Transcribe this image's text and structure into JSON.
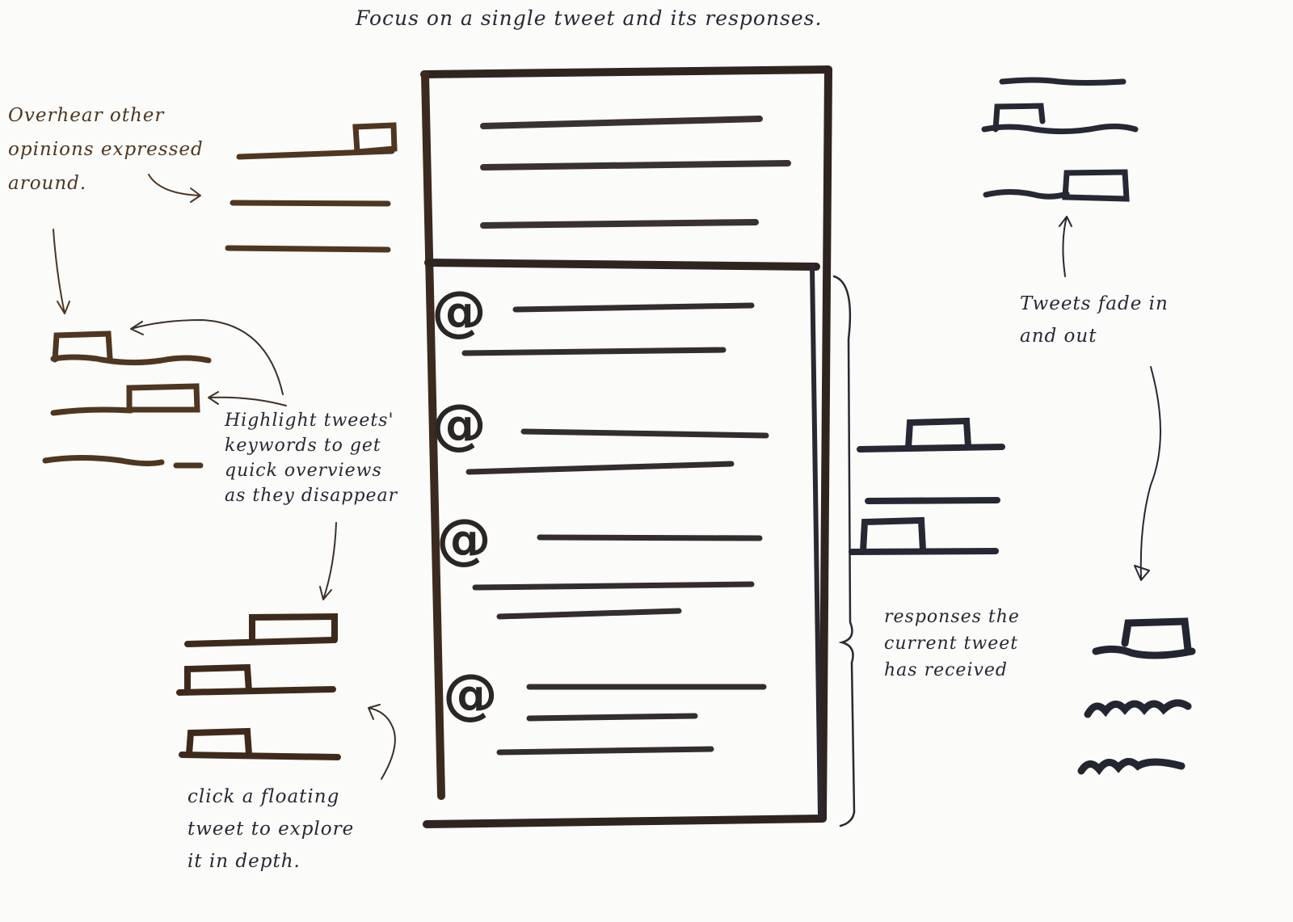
{
  "title": "Focus on a single tweet and its responses.",
  "annotations": {
    "overhear": "Overhear other\nopinions expressed\naround.",
    "highlight": "Highlight tweets'\nkeywords to get\nquick overviews\nas they disappear",
    "click": "click a floating\ntweet to explore\nit in depth.",
    "fade": "Tweets fade in\nand out",
    "responses": "responses the\ncurrent tweet\nhas received"
  },
  "mention_symbol": "@",
  "colors": {
    "brown_ink": "#4e3621",
    "dark_ink": "#262833",
    "paper": "#fbfbf9"
  }
}
